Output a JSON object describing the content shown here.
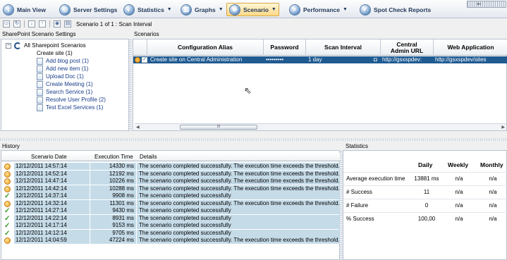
{
  "ribbon": {
    "items": [
      {
        "label": "Main View",
        "icon": "info-icon"
      },
      {
        "label": "Server Settings",
        "icon": "server-settings-icon"
      },
      {
        "label": "Statistics",
        "icon": "statistics-icon"
      },
      {
        "label": "Graphs",
        "icon": "graphs-icon"
      },
      {
        "label": "Scenario",
        "icon": "scenario-globe-icon"
      },
      {
        "label": "Performance",
        "icon": "performance-icon"
      },
      {
        "label": "Spot Check Reports",
        "icon": "spot-check-icon"
      }
    ]
  },
  "toolbar": {
    "counter": "Scenario 1 of 1 : Scan Interval"
  },
  "tree": {
    "section_label": "SharePoint Scenario Settings",
    "root_label": "All Sharepoint Scenarios",
    "items": [
      {
        "label": "Create site (1)"
      },
      {
        "label": "Add blog post (1)"
      },
      {
        "label": "Add new item (1)"
      },
      {
        "label": "Upload Doc (1)"
      },
      {
        "label": "Create Meeting (1)"
      },
      {
        "label": "Search Service (1)"
      },
      {
        "label": "Resolve User Profile (2)"
      },
      {
        "label": "Test Excel Services (1)"
      }
    ]
  },
  "scenarios": {
    "section_label": "Scenarios",
    "columns": [
      "Configuration Alias",
      "Password",
      "Scan Interval",
      "Central Admin URL",
      "Web Application"
    ],
    "row": {
      "alias": "Create site on Central Administration",
      "password": "•••••••••",
      "interval": "1 day",
      "admin_url": "http://gsxspdev:",
      "web_app": "http://gsxspdev/sites"
    },
    "scroll_thumb": "III"
  },
  "history": {
    "section_label": "History",
    "columns": [
      "Scenario Date",
      "Execution Time",
      "Details"
    ],
    "rows": [
      {
        "status": "warning",
        "date": "12/12/2011 14:57:14",
        "time": "14330 ms",
        "details": "The scenario completed successfully. The execution time exceeds the threshold."
      },
      {
        "status": "warning",
        "date": "12/12/2011 14:52:14",
        "time": "12192 ms",
        "details": "The scenario completed successfully. The execution time exceeds the threshold."
      },
      {
        "status": "warning",
        "date": "12/12/2011 14:47:14",
        "time": "10226 ms",
        "details": "The scenario completed successfully. The execution time exceeds the threshold."
      },
      {
        "status": "warning",
        "date": "12/12/2011 14:42:14",
        "time": "10288 ms",
        "details": "The scenario completed successfully. The execution time exceeds the threshold."
      },
      {
        "status": "ok",
        "date": "12/12/2011 14:37:14",
        "time": "9908 ms",
        "details": "The scenario completed successfully"
      },
      {
        "status": "warning",
        "date": "12/12/2011 14:32:14",
        "time": "11301 ms",
        "details": "The scenario completed successfully. The execution time exceeds the threshold."
      },
      {
        "status": "ok",
        "date": "12/12/2011 14:27:14",
        "time": "9430 ms",
        "details": "The scenario completed successfully"
      },
      {
        "status": "ok",
        "date": "12/12/2011 14:22:14",
        "time": "8931 ms",
        "details": "The scenario completed successfully"
      },
      {
        "status": "ok",
        "date": "12/12/2011 14:17:14",
        "time": "9153 ms",
        "details": "The scenario completed successfully"
      },
      {
        "status": "ok",
        "date": "12/12/2011 14:12:14",
        "time": "9705 ms",
        "details": "The scenario completed successfully"
      },
      {
        "status": "warning",
        "date": "12/12/2011 14:04:59",
        "time": "47224 ms",
        "details": "The scenario completed successfully. The execution time exceeds the threshold."
      }
    ]
  },
  "statistics": {
    "section_label": "Statistics",
    "columns": [
      "Daily",
      "Weekly",
      "Monthly"
    ],
    "rows": [
      {
        "label": "Average execution time",
        "daily": "13881 ms",
        "weekly": "n/a",
        "monthly": "n/a"
      },
      {
        "label": "# Success",
        "daily": "11",
        "weekly": "n/a",
        "monthly": "n/a"
      },
      {
        "label": "# Failure",
        "daily": "0",
        "weekly": "n/a",
        "monthly": "n/a"
      },
      {
        "label": "% Success",
        "daily": "100,00",
        "weekly": "n/a",
        "monthly": "n/a"
      }
    ]
  }
}
